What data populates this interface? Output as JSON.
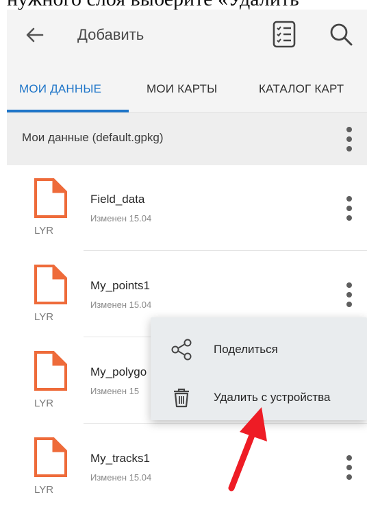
{
  "caption_top": "нужного слоя выберите «Удалить",
  "appbar": {
    "title": "Добавить"
  },
  "tabs": [
    {
      "label": "МОИ ДАННЫЕ"
    },
    {
      "label": "МОИ КАРТЫ"
    },
    {
      "label": "КАТАЛОГ КАРТ"
    }
  ],
  "section": {
    "title": "Мои данные (default.gpkg)"
  },
  "files": [
    {
      "name": "Field_data",
      "modified": "Изменен 15.04",
      "type": "LYR"
    },
    {
      "name": "My_points1",
      "modified": "Изменен 15.04",
      "type": "LYR"
    },
    {
      "name": "My_polygo",
      "modified": "Изменен 15",
      "type": "LYR"
    },
    {
      "name": "My_tracks1",
      "modified": "Изменен 15.04",
      "type": "LYR"
    }
  ],
  "context_menu": {
    "share": "Поделиться",
    "delete": "Удалить с устройства"
  },
  "colors": {
    "accent": "#1e75c8",
    "file_icon": "#ee6b3a",
    "annotation_arrow": "#ee1c25"
  }
}
